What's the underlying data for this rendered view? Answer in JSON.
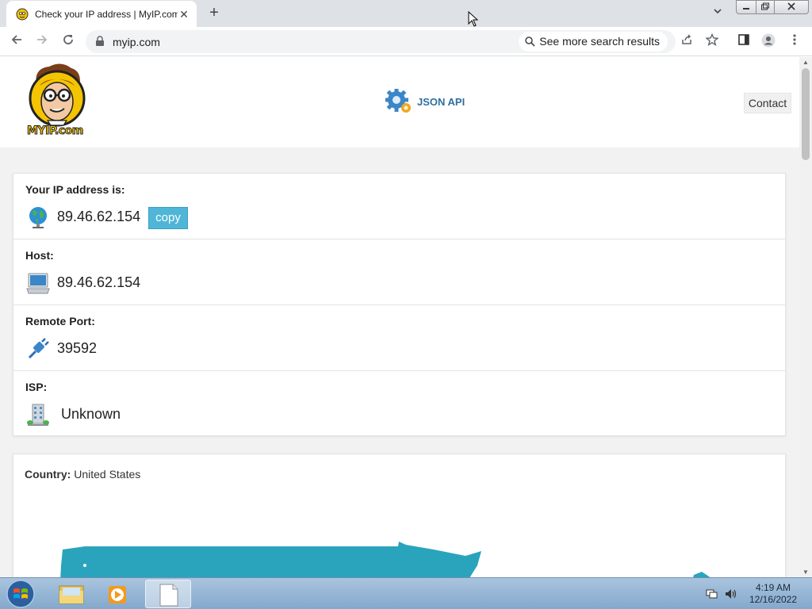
{
  "browser": {
    "tab_title": "Check your IP address | MyIP.com",
    "tab_close": "✕",
    "new_tab": "+",
    "url": "myip.com",
    "suggestion": "See more search results",
    "icons": [
      "back-icon",
      "forward-icon",
      "reload-icon",
      "lock-icon",
      "search-icon",
      "share-icon",
      "star-icon",
      "sidepanel-icon",
      "profile-icon",
      "menu-icon"
    ]
  },
  "site": {
    "logo_text": "MYIP.com",
    "json_api": "JSON API",
    "contact": "Contact",
    "accent_color": "#2f6f9e",
    "copy_color": "#4fb6d8"
  },
  "info": {
    "rows": [
      {
        "label": "Your IP address is:",
        "value": "89.46.62.154",
        "icon": "globe-icon"
      },
      {
        "label": "Host:",
        "value": "89.46.62.154",
        "icon": "computer-icon"
      },
      {
        "label": "Remote Port:",
        "value": "39592",
        "icon": "plug-icon"
      },
      {
        "label": "ISP:",
        "value": "Unknown",
        "icon": "building-icon"
      }
    ],
    "copy_label": "copy"
  },
  "country": {
    "label": "Country:",
    "value": "United States",
    "map_color": "#2aa4bd"
  },
  "taskbar": {
    "time": "4:19 AM",
    "date": "12/16/2022"
  }
}
